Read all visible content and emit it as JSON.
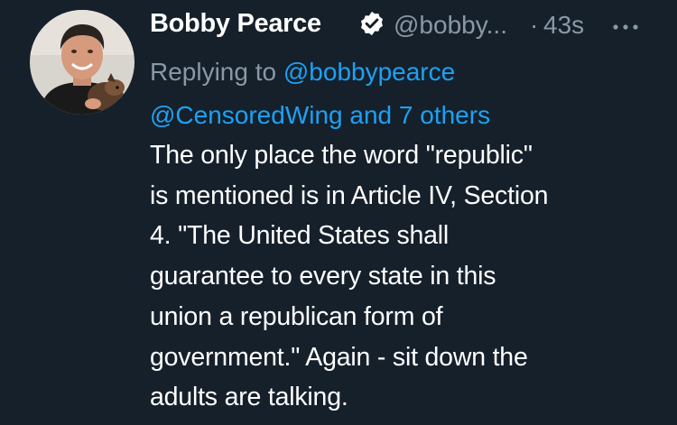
{
  "tweet": {
    "author_name": "Bobby Pearce",
    "handle": "@bobby...",
    "separator": "·",
    "timestamp": "43s",
    "verified_icon": "verified-badge-icon",
    "more_icon": "more-options-icon",
    "replying_to_label": "Replying to",
    "mention_1": "@bobbypearce",
    "mention_2": "@CensoredWing",
    "and_others": "and 7 others",
    "body_lines": [
      "The only place the word \"republic\"",
      "is mentioned is in Article IV, Section",
      "4. \"The United States shall",
      "guarantee to every state in this",
      "union a republican form of",
      "government.\" Again - sit down the",
      "adults are talking."
    ]
  },
  "colors": {
    "background": "#15202b",
    "primary_text": "#ffffff",
    "secondary_text": "#8899a6",
    "link": "#1da1f2"
  }
}
